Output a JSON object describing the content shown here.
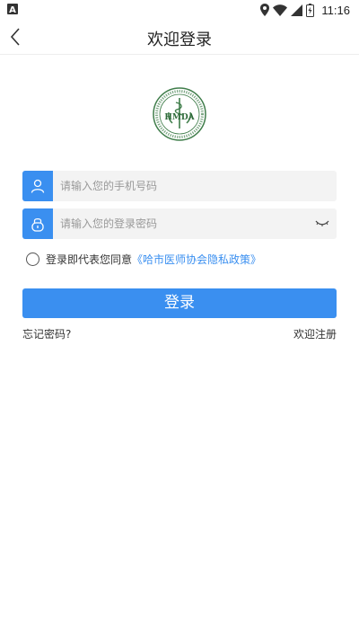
{
  "status_bar": {
    "time": "11:16",
    "icons": [
      "notification-a-icon",
      "location-icon",
      "wifi-icon",
      "signal-icon",
      "battery-icon"
    ]
  },
  "header": {
    "title": "欢迎登录"
  },
  "logo": {
    "text": "HMDA"
  },
  "phone_field": {
    "placeholder": "请输入您的手机号码",
    "value": ""
  },
  "password_field": {
    "placeholder": "请输入您的登录密码",
    "value": ""
  },
  "agreement": {
    "text": "登录即代表您同意",
    "policy_link": "《哈市医师协会隐私政策》"
  },
  "login_button": {
    "label": "登录"
  },
  "links": {
    "forgot_password": "忘记密码?",
    "register": "欢迎注册"
  },
  "colors": {
    "accent": "#3a8ff0",
    "field_bg": "#f3f3f3",
    "logo_green": "#3f7d4a"
  }
}
